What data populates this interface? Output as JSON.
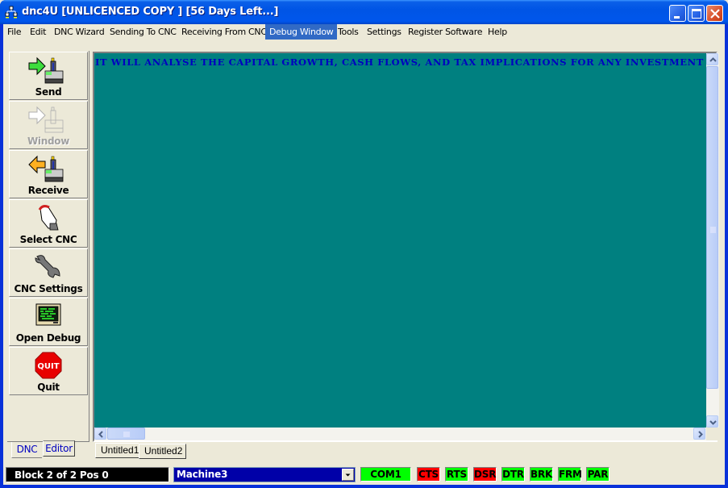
{
  "window": {
    "title": "dnc4U [UNLICENCED COPY ] [56  Days Left...]",
    "icon": "network-tree-icon"
  },
  "menu": {
    "items": [
      {
        "label": "File",
        "active": false
      },
      {
        "label": "Edit",
        "active": false
      },
      {
        "label": "DNC Wizard",
        "active": false
      },
      {
        "label": "Sending To CNC",
        "active": false
      },
      {
        "label": "Receiving From CNC",
        "active": false
      },
      {
        "label": "Debug Window",
        "active": true
      },
      {
        "label": "Tools",
        "active": false
      },
      {
        "label": "Settings",
        "active": false
      },
      {
        "label": "Register Software",
        "active": false
      },
      {
        "label": "Help",
        "active": false
      }
    ]
  },
  "sidebar": {
    "buttons": [
      {
        "label": "Send",
        "icon": "send-to-cnc-icon",
        "enabled": true
      },
      {
        "label": "Window",
        "icon": "window-cnc-icon",
        "enabled": false
      },
      {
        "label": "Receive",
        "icon": "receive-from-cnc-icon",
        "enabled": true
      },
      {
        "label": "Select CNC",
        "icon": "hand-pointer-icon",
        "enabled": true
      },
      {
        "label": "CNC Settings",
        "icon": "wrench-icon",
        "enabled": true
      },
      {
        "label": "Open Debug",
        "icon": "monitor-icon",
        "enabled": true
      },
      {
        "label": "Quit",
        "icon": "quit-stop-sign-icon",
        "enabled": true
      }
    ],
    "tabs": [
      {
        "label": "DNC",
        "active": true
      },
      {
        "label": "Editor",
        "active": false
      }
    ]
  },
  "editor": {
    "content": "IT WILL ANALYSE THE CAPITAL GROWTH, CASH FLOWS, AND TAX IMPLICATIONS FOR ANY INVESTMENT PROPERTY",
    "colors": {
      "background": "#008080",
      "text": "#0000c0"
    }
  },
  "document_tabs": [
    {
      "label": "Untitled1",
      "active": false
    },
    {
      "label": "Untitled2",
      "active": true
    }
  ],
  "statusbar": {
    "block_info": "Block 2 of 2 Pos 0",
    "machine": "Machine3",
    "port": "COM1",
    "signals": [
      {
        "label": "CTS",
        "state": "off"
      },
      {
        "label": "RTS",
        "state": "on"
      },
      {
        "label": "DSR",
        "state": "off"
      },
      {
        "label": "DTR",
        "state": "on"
      },
      {
        "label": "BRK",
        "state": "on"
      },
      {
        "label": "FRM",
        "state": "on"
      },
      {
        "label": "PAR",
        "state": "on"
      }
    ],
    "colors": {
      "on": "#00ff00",
      "off": "#ff0000"
    }
  }
}
